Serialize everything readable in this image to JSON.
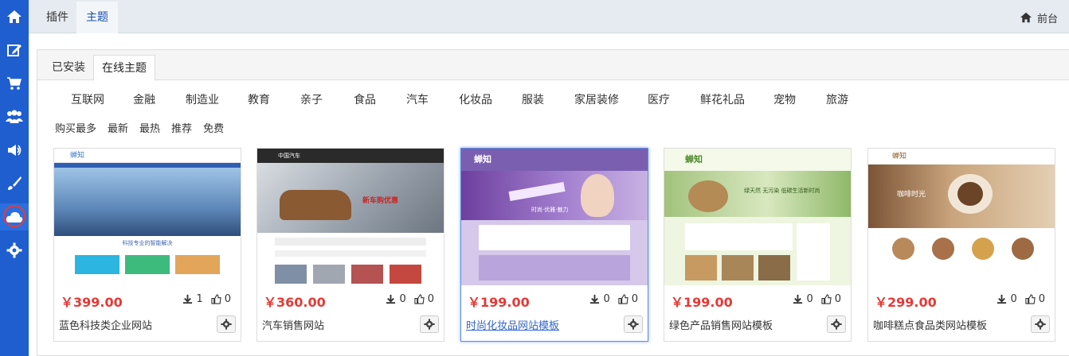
{
  "top_tabs": [
    {
      "label": "插件"
    },
    {
      "label": "主题"
    }
  ],
  "front_label": "前台",
  "sub_tabs": [
    {
      "label": "已安装"
    },
    {
      "label": "在线主题"
    }
  ],
  "categories": [
    "互联网",
    "金融",
    "制造业",
    "教育",
    "亲子",
    "食品",
    "汽车",
    "化妆品",
    "服装",
    "家居装修",
    "医疗",
    "鲜花礼品",
    "宠物",
    "旅游"
  ],
  "sorts": [
    "购买最多",
    "最新",
    "最热",
    "推荐",
    "免费"
  ],
  "sidebar_icons": [
    "home-icon",
    "edit-icon",
    "cart-icon",
    "users-icon",
    "megaphone-icon",
    "brush-icon",
    "cloud-icon",
    "gear-icon"
  ],
  "themes": [
    {
      "price": "￥399.00",
      "downloads": "1",
      "likes": "0",
      "name": "蓝色科技类企业网站",
      "thumb": {
        "logo": "蝉知",
        "banner": "科技专业的智能解决"
      }
    },
    {
      "price": "￥360.00",
      "downloads": "0",
      "likes": "0",
      "name": "汽车销售网站",
      "thumb": {
        "logo": "中国汽车",
        "banner": "新车购优惠"
      }
    },
    {
      "price": "￥199.00",
      "downloads": "0",
      "likes": "0",
      "name": "时尚化妆品网站模板",
      "thumb": {
        "logo": "蝉知",
        "banner": "时尚·优雅·魅力"
      }
    },
    {
      "price": "￥199.00",
      "downloads": "0",
      "likes": "0",
      "name": "绿色产品销售网站模板",
      "thumb": {
        "logo": "蝉知",
        "banner": "绿天然 无污染 低碳生活新时尚"
      }
    },
    {
      "price": "￥299.00",
      "downloads": "0",
      "likes": "0",
      "name": "咖啡糕点食品类网站模板",
      "thumb": {
        "logo": "蝉知",
        "banner": "咖啡时光"
      }
    }
  ],
  "colors": {
    "sidebar": "#1f5ecf",
    "price": "#e53935",
    "accent": "#1a4fb3"
  }
}
